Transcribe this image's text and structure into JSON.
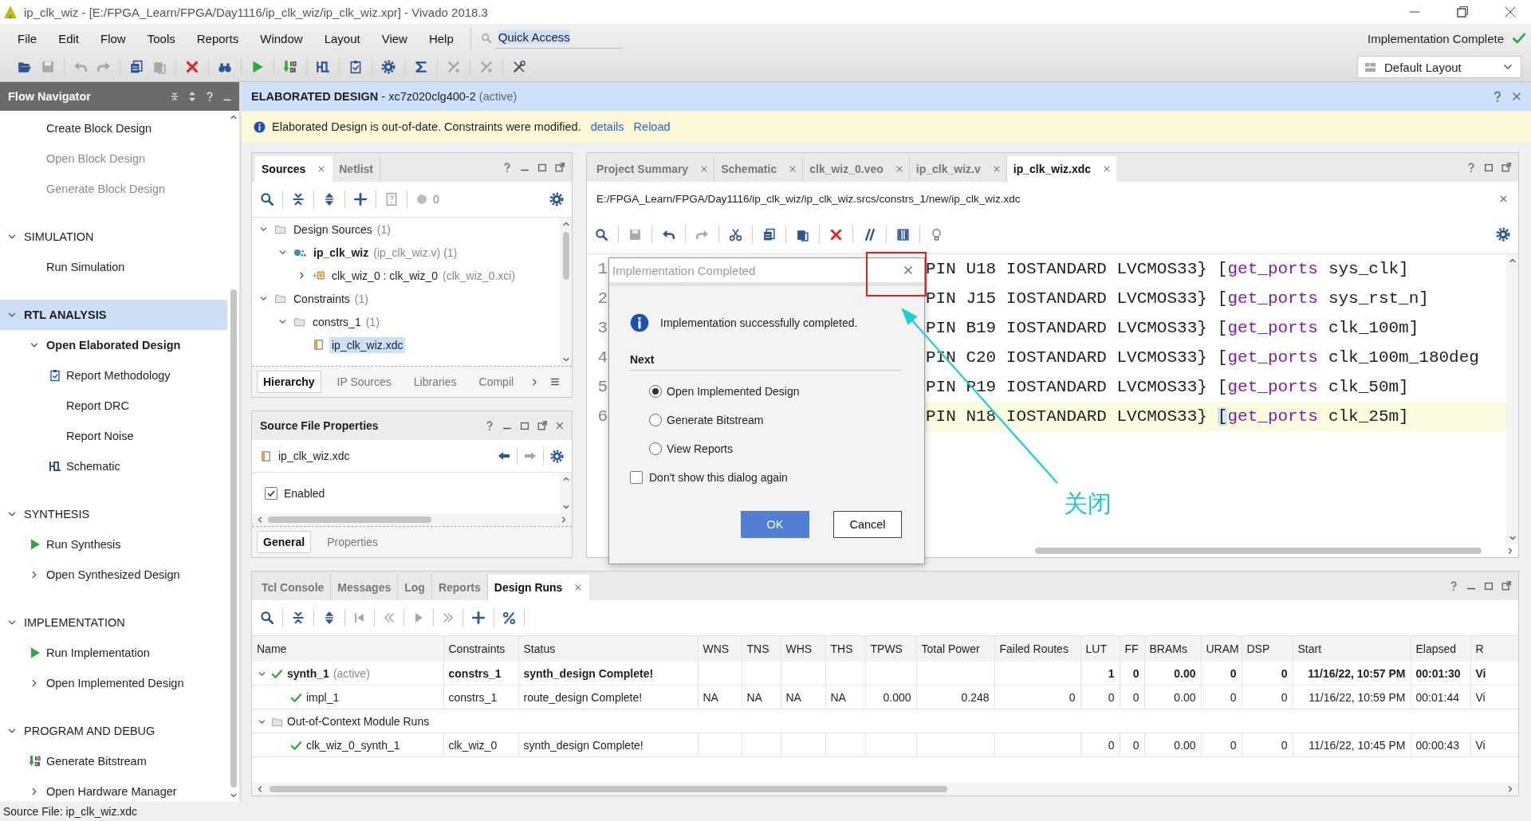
{
  "window": {
    "title": "ip_clk_wiz - [E:/FPGA_Learn/FPGA/Day1116/ip_clk_wiz/ip_clk_wiz.xpr] - Vivado 2018.3"
  },
  "menu": [
    "File",
    "Edit",
    "Flow",
    "Tools",
    "Reports",
    "Window",
    "Layout",
    "View",
    "Help"
  ],
  "quick_access": {
    "value": "Quick Access"
  },
  "run_status": {
    "text": "Implementation Complete",
    "complete": true
  },
  "layout_select": {
    "value": "Default Layout"
  },
  "flow_navigator": {
    "title": "Flow Navigator",
    "sections": [
      {
        "items": [
          {
            "label": "Create Block Design",
            "kind": "plain",
            "disabled": false
          },
          {
            "label": "Open Block Design",
            "kind": "plain",
            "disabled": true
          },
          {
            "label": "Generate Block Design",
            "kind": "plain",
            "disabled": true
          }
        ]
      },
      {
        "title": "SIMULATION",
        "expanded": true,
        "selected": false,
        "items": [
          {
            "label": "Run Simulation",
            "kind": "plain",
            "disabled": false
          }
        ]
      },
      {
        "title": "RTL ANALYSIS",
        "expanded": true,
        "selected": true,
        "items": [
          {
            "label": "Open Elaborated Design",
            "kind": "group",
            "expanded": true,
            "disabled": false,
            "children": [
              {
                "label": "Report Methodology",
                "kind": "report",
                "disabled": false
              },
              {
                "label": "Report DRC",
                "kind": "plain",
                "disabled": false
              },
              {
                "label": "Report Noise",
                "kind": "plain",
                "disabled": false
              },
              {
                "label": "Schematic",
                "kind": "schematic",
                "disabled": false
              }
            ]
          }
        ]
      },
      {
        "title": "SYNTHESIS",
        "expanded": true,
        "selected": false,
        "items": [
          {
            "label": "Run Synthesis",
            "kind": "run",
            "disabled": false
          },
          {
            "label": "Open Synthesized Design",
            "kind": "group",
            "expanded": false,
            "disabled": false
          }
        ]
      },
      {
        "title": "IMPLEMENTATION",
        "expanded": true,
        "selected": false,
        "items": [
          {
            "label": "Run Implementation",
            "kind": "run",
            "disabled": false
          },
          {
            "label": "Open Implemented Design",
            "kind": "group",
            "expanded": false,
            "disabled": false
          }
        ]
      },
      {
        "title": "PROGRAM AND DEBUG",
        "expanded": true,
        "selected": false,
        "items": [
          {
            "label": "Generate Bitstream",
            "kind": "bitstream",
            "disabled": false
          },
          {
            "label": "Open Hardware Manager",
            "kind": "group",
            "expanded": false,
            "disabled": false
          }
        ]
      }
    ]
  },
  "design_header": {
    "title": "ELABORATED DESIGN",
    "part": "- xc7z020clg400-2",
    "note": "(active)"
  },
  "banner": {
    "message": "Elaborated Design is out-of-date. Constraints were modified.",
    "links": [
      "details",
      "Reload"
    ]
  },
  "sources": {
    "tabs": [
      {
        "label": "Sources",
        "selected": true,
        "closable": true
      },
      {
        "label": "Netlist",
        "selected": false,
        "closable": false
      }
    ],
    "count": "0",
    "tree": [
      {
        "label": "Design Sources",
        "note": "(1)",
        "kind": "folder",
        "bold": false,
        "expanded": true,
        "selected": false,
        "children": [
          {
            "label": "ip_clk_wiz",
            "note": "(ip_clk_wiz.v) (1)",
            "kind": "module",
            "bold": true,
            "expanded": true,
            "selected": false,
            "children": [
              {
                "label": "clk_wiz_0 : clk_wiz_0",
                "note": "(clk_wiz_0.xci)",
                "kind": "ip",
                "bold": false,
                "expanded": false,
                "selected": false
              }
            ]
          }
        ]
      },
      {
        "label": "Constraints",
        "note": "(1)",
        "kind": "folder",
        "bold": false,
        "expanded": true,
        "selected": false,
        "children": [
          {
            "label": "constrs_1",
            "note": "(1)",
            "kind": "folder",
            "bold": false,
            "expanded": true,
            "selected": false,
            "children": [
              {
                "label": "ip_clk_wiz.xdc",
                "kind": "file",
                "bold": false,
                "selected": true
              }
            ]
          }
        ]
      }
    ],
    "bottom_tabs": [
      {
        "label": "Hierarchy",
        "selected": true
      },
      {
        "label": "IP Sources",
        "selected": false
      },
      {
        "label": "Libraries",
        "selected": false
      },
      {
        "label": "Compil",
        "selected": false
      }
    ]
  },
  "properties": {
    "title": "Source File Properties",
    "file": "ip_clk_wiz.xdc",
    "enabled": {
      "label": "Enabled",
      "checked": true
    },
    "tabs": [
      {
        "label": "General",
        "selected": true
      },
      {
        "label": "Properties",
        "selected": false
      }
    ]
  },
  "editor": {
    "tabs": [
      {
        "label": "Project Summary",
        "selected": false
      },
      {
        "label": "Schematic",
        "selected": false
      },
      {
        "label": "clk_wiz_0.veo",
        "selected": false
      },
      {
        "label": "ip_clk_wiz.v",
        "selected": false
      },
      {
        "label": "ip_clk_wiz.xdc",
        "selected": true
      }
    ],
    "path": "E:/FPGA_Learn/FPGA/Day1116/ip_clk_wiz/ip_clk_wiz.srcs/constrs_1/new/ip_clk_wiz.xdc",
    "lines": [
      {
        "number": "1",
        "code": "PIN U18 IOSTANDARD LVCMOS33}",
        "bracket": "[",
        "command": "get_ports",
        "arg": "sys_clk]",
        "current": false
      },
      {
        "number": "2",
        "code": "PIN J15 IOSTANDARD LVCMOS33}",
        "bracket": "[",
        "command": "get_ports",
        "arg": "sys_rst_n]",
        "current": false
      },
      {
        "number": "3",
        "code": "PIN B19 IOSTANDARD LVCMOS33}",
        "bracket": "[",
        "command": "get_ports",
        "arg": "clk_100m]",
        "current": false
      },
      {
        "number": "4",
        "code": "PIN C20 IOSTANDARD LVCMOS33}",
        "bracket": "[",
        "command": "get_ports",
        "arg": "clk_100m_180deg",
        "current": false
      },
      {
        "number": "5",
        "code": "PIN P19 IOSTANDARD LVCMOS33}",
        "bracket": "[",
        "command": "get_ports",
        "arg": "clk_50m]",
        "current": false
      },
      {
        "number": "6",
        "code": "PIN N18 IOSTANDARD LVCMOS33}",
        "bracket": "[",
        "command": "get_ports",
        "arg": "clk_25m]",
        "current": true
      }
    ]
  },
  "dialog": {
    "title": "Implementation Completed",
    "message": "Implementation successfully completed.",
    "section": "Next",
    "options": [
      {
        "label": "Open Implemented Design",
        "selected": true
      },
      {
        "label": "Generate Bitstream",
        "selected": false
      },
      {
        "label": "View Reports",
        "selected": false
      }
    ],
    "dont_show": {
      "label": "Don't show this dialog again",
      "checked": false
    },
    "buttons": [
      {
        "label": "OK",
        "kind": "primary"
      },
      {
        "label": "Cancel",
        "kind": "secondary"
      }
    ]
  },
  "annotation": {
    "label": "关闭"
  },
  "runs": {
    "tabs": [
      {
        "label": "Tcl Console",
        "selected": false,
        "closable": false
      },
      {
        "label": "Messages",
        "selected": false,
        "closable": false
      },
      {
        "label": "Log",
        "selected": false,
        "closable": false
      },
      {
        "label": "Reports",
        "selected": false,
        "closable": false
      },
      {
        "label": "Design Runs",
        "selected": true,
        "closable": true
      }
    ],
    "columns": [
      "Name",
      "Constraints",
      "Status",
      "WNS",
      "TNS",
      "WHS",
      "THS",
      "TPWS",
      "Total Power",
      "Failed Routes",
      "LUT",
      "FF",
      "BRAMs",
      "URAM",
      "DSP",
      "Start",
      "Elapsed",
      "R"
    ],
    "rows": [
      {
        "name": "synth_1",
        "note": "(active)",
        "kind": "run",
        "bold": true,
        "expanded": true,
        "cells": [
          "constrs_1",
          "synth_design Complete!",
          null,
          null,
          null,
          null,
          null,
          null,
          null,
          "1",
          "0",
          "0.00",
          "0",
          "0",
          "11/16/22, 10:57 PM",
          "00:01:30",
          "Vi"
        ],
        "children": [
          {
            "name": "impl_1",
            "kind": "run",
            "bold": false,
            "cells": [
              "constrs_1",
              "route_design Complete!",
              "NA",
              "NA",
              "NA",
              "NA",
              "0.000",
              "0.248",
              "0",
              "0",
              "0",
              "0.00",
              "0",
              "0",
              "11/16/22, 10:59 PM",
              "00:01:44",
              "Vi"
            ]
          }
        ]
      },
      {
        "name": "Out-of-Context Module Runs",
        "kind": "group",
        "expanded": true,
        "children": [
          {
            "name": "clk_wiz_0_synth_1",
            "kind": "run",
            "bold": false,
            "cells": [
              "clk_wiz_0",
              "synth_design Complete!",
              null,
              null,
              null,
              null,
              null,
              null,
              null,
              "0",
              "0",
              "0.00",
              "0",
              "0",
              "11/16/22, 10:45 PM",
              "00:00:43",
              "Vi"
            ]
          }
        ]
      }
    ]
  },
  "status_bar": "Source File: ip_clk_wiz.xdc"
}
